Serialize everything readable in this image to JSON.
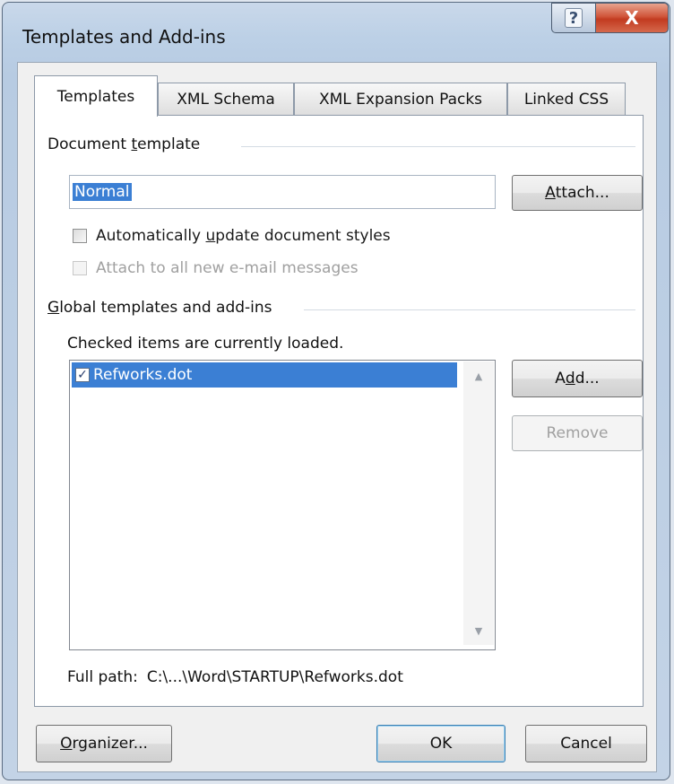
{
  "window": {
    "title": "Templates and Add-ins",
    "help_icon": "?",
    "close_icon": "X"
  },
  "tabs": [
    {
      "label": "Templates",
      "active": true
    },
    {
      "label": "XML Schema",
      "active": false
    },
    {
      "label": "XML Expansion Packs",
      "active": false
    },
    {
      "label": "Linked CSS",
      "active": false
    }
  ],
  "document_template": {
    "group_label_pre": "Document ",
    "group_label_key": "t",
    "group_label_post": "emplate",
    "value": "Normal",
    "attach_pre": "",
    "attach_key": "A",
    "attach_post": "ttach...",
    "auto_update_pre": "Automatically ",
    "auto_update_key": "u",
    "auto_update_post": "pdate document styles",
    "auto_update_checked": false,
    "attach_email_label": "Attach to all new e-mail messages",
    "attach_email_checked": false,
    "attach_email_enabled": false
  },
  "global_templates": {
    "group_label_key": "G",
    "group_label_post": "lobal templates and add-ins",
    "hint": "Checked items are currently loaded.",
    "items": [
      {
        "label": "Refworks.dot",
        "checked": true,
        "selected": true
      }
    ],
    "add_pre": "A",
    "add_key": "d",
    "add_post": "d...",
    "remove_label": "Remove",
    "remove_enabled": false,
    "full_path_label": "Full path:",
    "full_path_value": "C:\\...\\Word\\STARTUP\\Refworks.dot"
  },
  "footer": {
    "organizer_key": "O",
    "organizer_post": "rganizer...",
    "ok_label": "OK",
    "cancel_label": "Cancel"
  }
}
